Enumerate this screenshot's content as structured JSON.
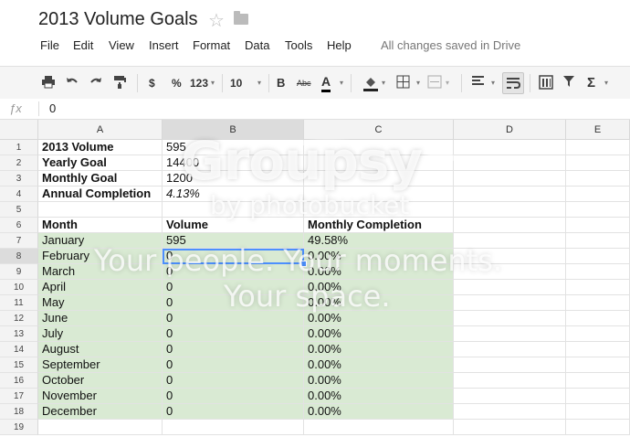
{
  "doc": {
    "title": "2013 Volume Goals",
    "saved_status": "All changes saved in Drive"
  },
  "menu": [
    "File",
    "Edit",
    "View",
    "Insert",
    "Format",
    "Data",
    "Tools",
    "Help"
  ],
  "toolbar": {
    "currency": "$",
    "percent": "%",
    "number_format": "123",
    "font_size": "10",
    "bold": "B",
    "strikethrough": "Abc",
    "text_color": "A"
  },
  "formula_bar": {
    "label": "fx",
    "value": "0"
  },
  "columns": [
    "A",
    "B",
    "C",
    "D",
    "E"
  ],
  "rows": [
    "1",
    "2",
    "3",
    "4",
    "5",
    "6",
    "7",
    "8",
    "9",
    "10",
    "11",
    "12",
    "13",
    "14",
    "15",
    "16",
    "17",
    "18",
    "19"
  ],
  "summary": [
    {
      "label": "2013 Volume",
      "value": "595"
    },
    {
      "label": "Yearly Goal",
      "value": "14400"
    },
    {
      "label": "Monthly Goal",
      "value": "1200"
    },
    {
      "label": "Annual Completion",
      "value": "4.13%"
    }
  ],
  "table_headers": {
    "month": "Month",
    "volume": "Volume",
    "completion": "Monthly Completion"
  },
  "months": [
    {
      "month": "January",
      "volume": "595",
      "completion": "49.58%"
    },
    {
      "month": "February",
      "volume": "0",
      "completion": "0.00%"
    },
    {
      "month": "March",
      "volume": "0",
      "completion": "0.00%"
    },
    {
      "month": "April",
      "volume": "0",
      "completion": "0.00%"
    },
    {
      "month": "May",
      "volume": "0",
      "completion": "0.00%"
    },
    {
      "month": "June",
      "volume": "0",
      "completion": "0.00%"
    },
    {
      "month": "July",
      "volume": "0",
      "completion": "0.00%"
    },
    {
      "month": "August",
      "volume": "0",
      "completion": "0.00%"
    },
    {
      "month": "September",
      "volume": "0",
      "completion": "0.00%"
    },
    {
      "month": "October",
      "volume": "0",
      "completion": "0.00%"
    },
    {
      "month": "November",
      "volume": "0",
      "completion": "0.00%"
    },
    {
      "month": "December",
      "volume": "0",
      "completion": "0.00%"
    }
  ],
  "selected": {
    "column": "B",
    "row": "8"
  },
  "watermark": {
    "logo": "Groupsy",
    "byline": "by photobucket",
    "tagline1": "Your people. Your moments.",
    "tagline2": "Your space."
  },
  "colors": {
    "highlight": "#d9ead3",
    "selection": "#4d90fe",
    "header_bg": "#f3f3f3"
  },
  "icons": [
    "print-icon",
    "undo-icon",
    "redo-icon",
    "paint-format-icon",
    "fill-color-icon",
    "borders-icon",
    "merge-cells-icon",
    "align-left-icon",
    "wrap-text-icon",
    "pivot-table-icon",
    "filter-icon",
    "functions-icon"
  ]
}
